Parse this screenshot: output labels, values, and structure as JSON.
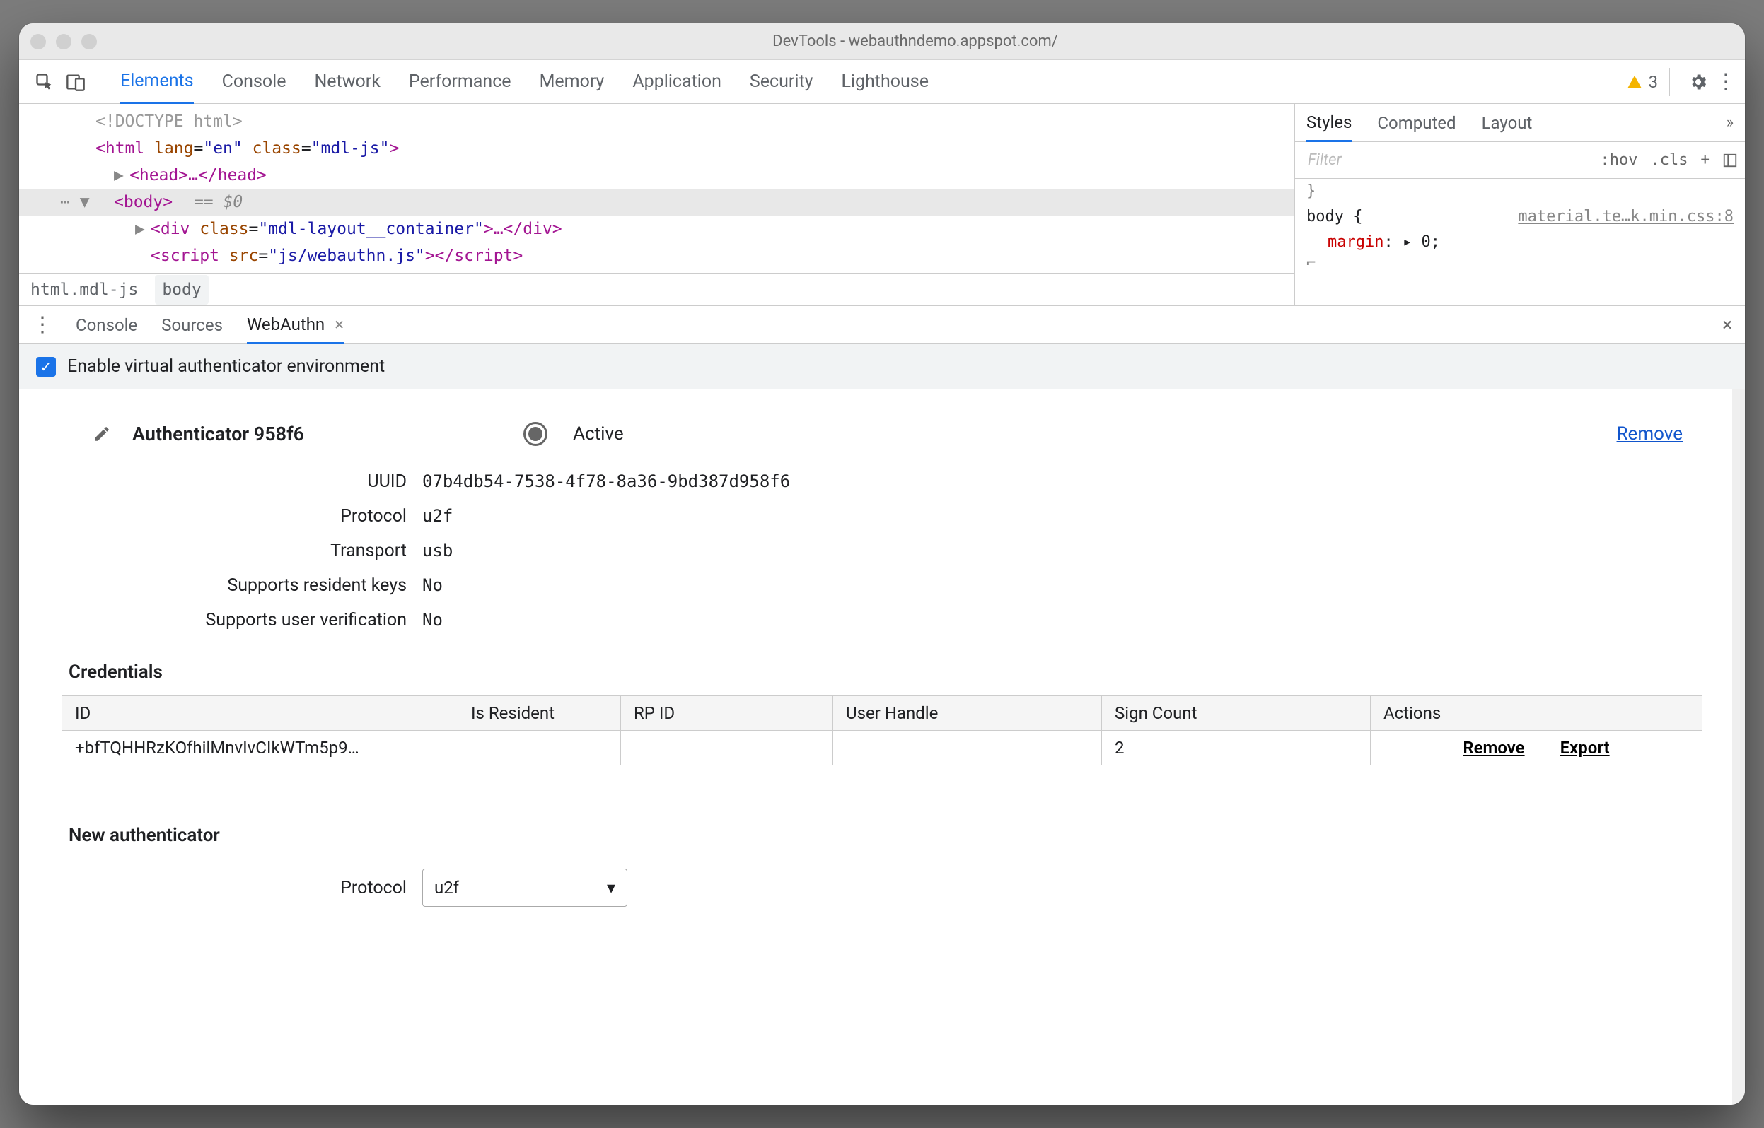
{
  "window": {
    "title": "DevTools - webauthndemo.appspot.com/"
  },
  "topTabs": {
    "elements": "Elements",
    "console": "Console",
    "network": "Network",
    "performance": "Performance",
    "memory": "Memory",
    "application": "Application",
    "security": "Security",
    "lighthouse": "Lighthouse"
  },
  "warnCount": "3",
  "dom": {
    "l1": "<!DOCTYPE html>",
    "l2a": "<",
    "l2t": "html",
    "l2b": " lang",
    "l2c": "\"en\"",
    "l2d": " class",
    "l2e": "\"mdl-js\"",
    "l2f": ">",
    "l3a": "<",
    "l3t": "head",
    "l3b": ">…</",
    "l3c": "head",
    "l3d": ">",
    "l4a": "<",
    "l4t": "body",
    "l4b": ">",
    "l4eq": " == $0",
    "l5a": "<",
    "l5t": "div",
    "l5b": " class",
    "l5c": "\"mdl-layout__container\"",
    "l5d": ">…</",
    "l5e": "div",
    "l5f": ">",
    "l6a": "<",
    "l6t": "script",
    "l6b": " src",
    "l6c": "\"js/webauthn.js\"",
    "l6d": "></",
    "l6e": "script",
    "l6f": ">"
  },
  "breadcrumb": {
    "a": "html.mdl-js",
    "b": "body"
  },
  "stylesTabs": {
    "styles": "Styles",
    "computed": "Computed",
    "layout": "Layout"
  },
  "stylesTools": {
    "filter": "Filter",
    "hov": ":hov",
    "cls": ".cls",
    "plus": "+"
  },
  "styles": {
    "brace1": "}",
    "sel": "body {",
    "srclink": "material.te…k.min.css:8",
    "prop": "margin",
    "val": "0",
    "end": ";",
    "brace2": "}"
  },
  "drawerTabs": {
    "console": "Console",
    "sources": "Sources",
    "webauthn": "WebAuthn"
  },
  "drawer": {
    "checkbox": "Enable virtual authenticator environment",
    "auth": {
      "name": "Authenticator 958f6",
      "active": "Active",
      "remove": "Remove",
      "uuid_l": "UUID",
      "uuid_v": "07b4db54-7538-4f78-8a36-9bd387d958f6",
      "proto_l": "Protocol",
      "proto_v": "u2f",
      "trans_l": "Transport",
      "trans_v": "usb",
      "res_l": "Supports resident keys",
      "res_v": "No",
      "uv_l": "Supports user verification",
      "uv_v": "No"
    },
    "credHead": "Credentials",
    "credCols": {
      "id": "ID",
      "res": "Is Resident",
      "rp": "RP ID",
      "uh": "User Handle",
      "sc": "Sign Count",
      "act": "Actions"
    },
    "credRow": {
      "id": "+bfTQHHRzKOfhilMnvIvCIkWTm5p9…",
      "sc": "2",
      "remove": "Remove",
      "export": "Export"
    },
    "newHead": "New authenticator",
    "newProtoLabel": "Protocol",
    "newProtoValue": "u2f"
  }
}
